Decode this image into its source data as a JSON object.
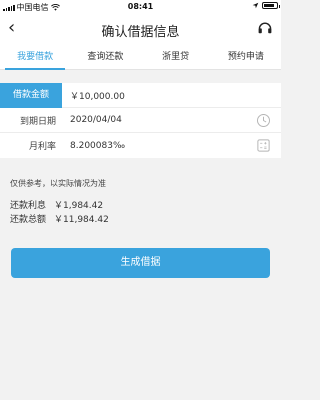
{
  "status_bar": {
    "carrier": "中国电信",
    "time": "08:41"
  },
  "nav": {
    "title": "确认借据信息"
  },
  "tabs": [
    {
      "label": "我要借款",
      "active": true
    },
    {
      "label": "查询还款",
      "active": false
    },
    {
      "label": "浙里贷",
      "active": false
    },
    {
      "label": "预约申请",
      "active": false
    }
  ],
  "form": {
    "amount_label": "借款金额",
    "amount_value": "￥10,000.00",
    "due_label": "到期日期",
    "due_value": "2020/04/04",
    "rate_label": "月利率",
    "rate_value": "8.200083‰"
  },
  "note": "仅供参考，以实际情况为准",
  "summary": {
    "interest_label": "还款利息",
    "interest_value": "￥1,984.42",
    "total_label": "还款总额",
    "total_value": "￥11,984.42"
  },
  "button": {
    "label": "生成借据"
  },
  "colors": {
    "accent": "#3aa3dd"
  },
  "icons": {
    "due_icon": "clock-icon",
    "rate_icon": "calculator-icon",
    "support_icon": "headset-icon"
  },
  "battery_level": 0.8
}
